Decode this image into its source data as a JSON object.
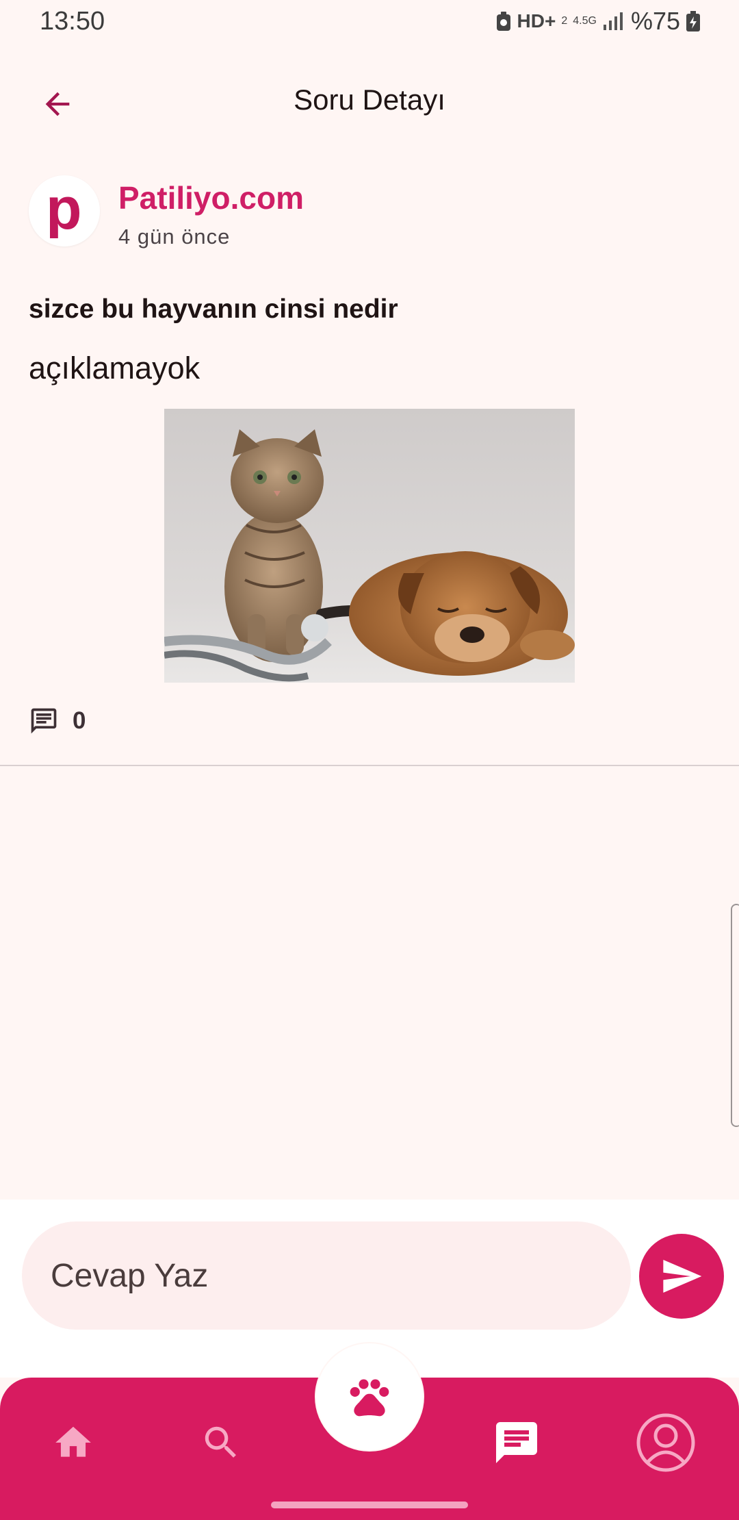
{
  "status_bar": {
    "time": "13:50",
    "network": "HD+",
    "network_sub": "2",
    "data_type": "4.5G",
    "battery": "%75"
  },
  "header": {
    "title": "Soru Detayı"
  },
  "post": {
    "author_name": "Patiliyo.com",
    "avatar_letter": "p",
    "time_ago": "4 gün önce",
    "title": "sizce bu hayvanın cinsi nedir",
    "description": "açıklamayok",
    "comment_count": "0"
  },
  "reply": {
    "placeholder": "Cevap Yaz"
  },
  "nav": {
    "items": [
      "home-icon",
      "search-icon",
      "paw-icon",
      "chat-icon",
      "profile-icon"
    ],
    "active": "chat-icon"
  },
  "colors": {
    "accent": "#d81b60",
    "author": "#cf1f66",
    "background": "#fff6f4",
    "input_bg": "#fdeeee"
  }
}
